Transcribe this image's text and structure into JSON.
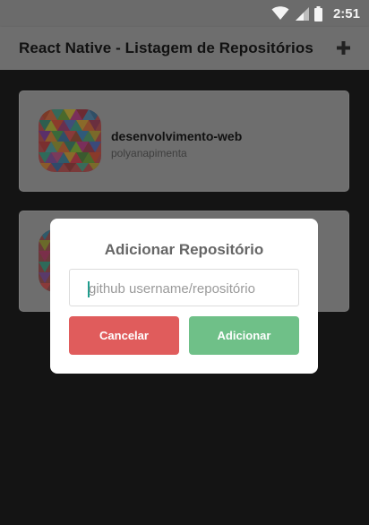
{
  "status_bar": {
    "time": "2:51",
    "icons": [
      "wifi-icon",
      "signal-icon",
      "battery-icon"
    ]
  },
  "header": {
    "title": "React Native - Listagem de Repositórios",
    "add_icon": "plus-icon"
  },
  "repositories": [
    {
      "name": "desenvolvimento-web",
      "owner": "polyanapimenta"
    },
    {
      "name": "",
      "owner": ""
    }
  ],
  "modal": {
    "title": "Adicionar Repositório",
    "input_placeholder": "github username/repositório",
    "cancel_label": "Cancelar",
    "add_label": "Adicionar"
  },
  "colors": {
    "cancel": "#e05c5c",
    "add": "#6fc088",
    "caret": "#1f9d8e"
  }
}
